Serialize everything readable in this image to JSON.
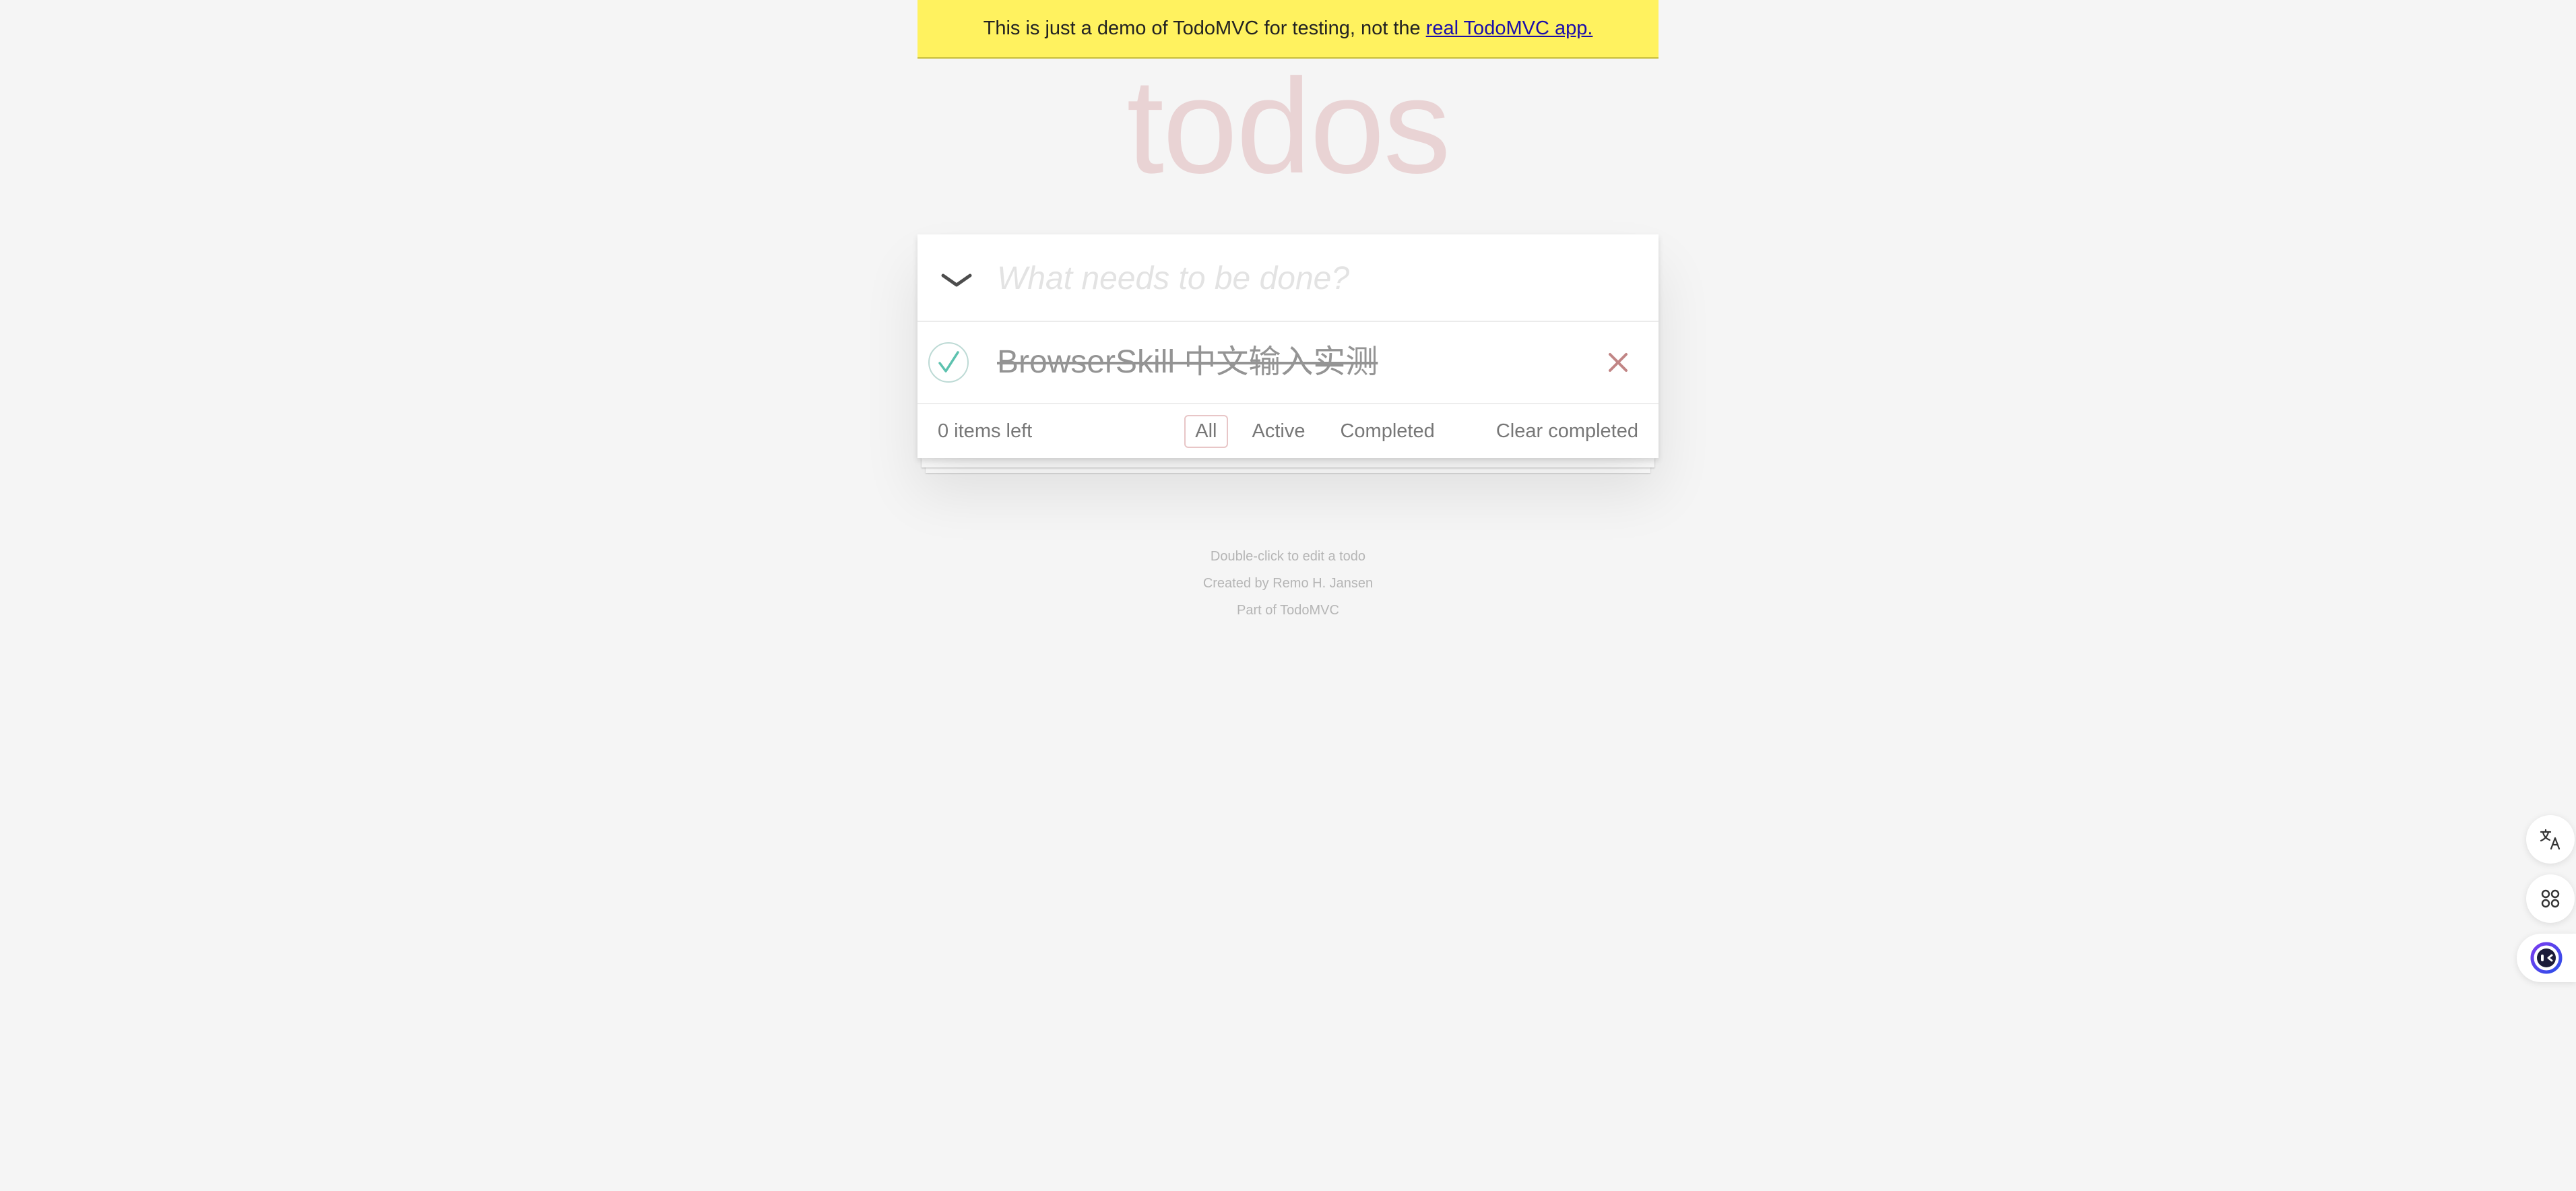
{
  "banner": {
    "text": "This is just a demo of TodoMVC for testing, not the",
    "link_text": "real TodoMVC app."
  },
  "app": {
    "title": "todos",
    "new_todo_placeholder": "What needs to be done?",
    "todos": [
      {
        "label": "BrowserSkill 中文输入实测",
        "completed": true
      }
    ],
    "footer": {
      "count_text": "0 items left",
      "filters": [
        "All",
        "Active",
        "Completed"
      ],
      "selected_filter": "All",
      "clear_completed": "Clear completed"
    }
  },
  "info": {
    "line1": "Double-click to edit a todo",
    "line2": "Created by Remo H. Jansen",
    "line3": "Part of TodoMVC"
  },
  "colors": {
    "banner_bg": "#fff25f",
    "title": "#b83f45",
    "check": "#5dc2af",
    "destroy": "#c18585"
  },
  "widgets": [
    "translate-icon",
    "apps-icon",
    "assistant-icon"
  ]
}
